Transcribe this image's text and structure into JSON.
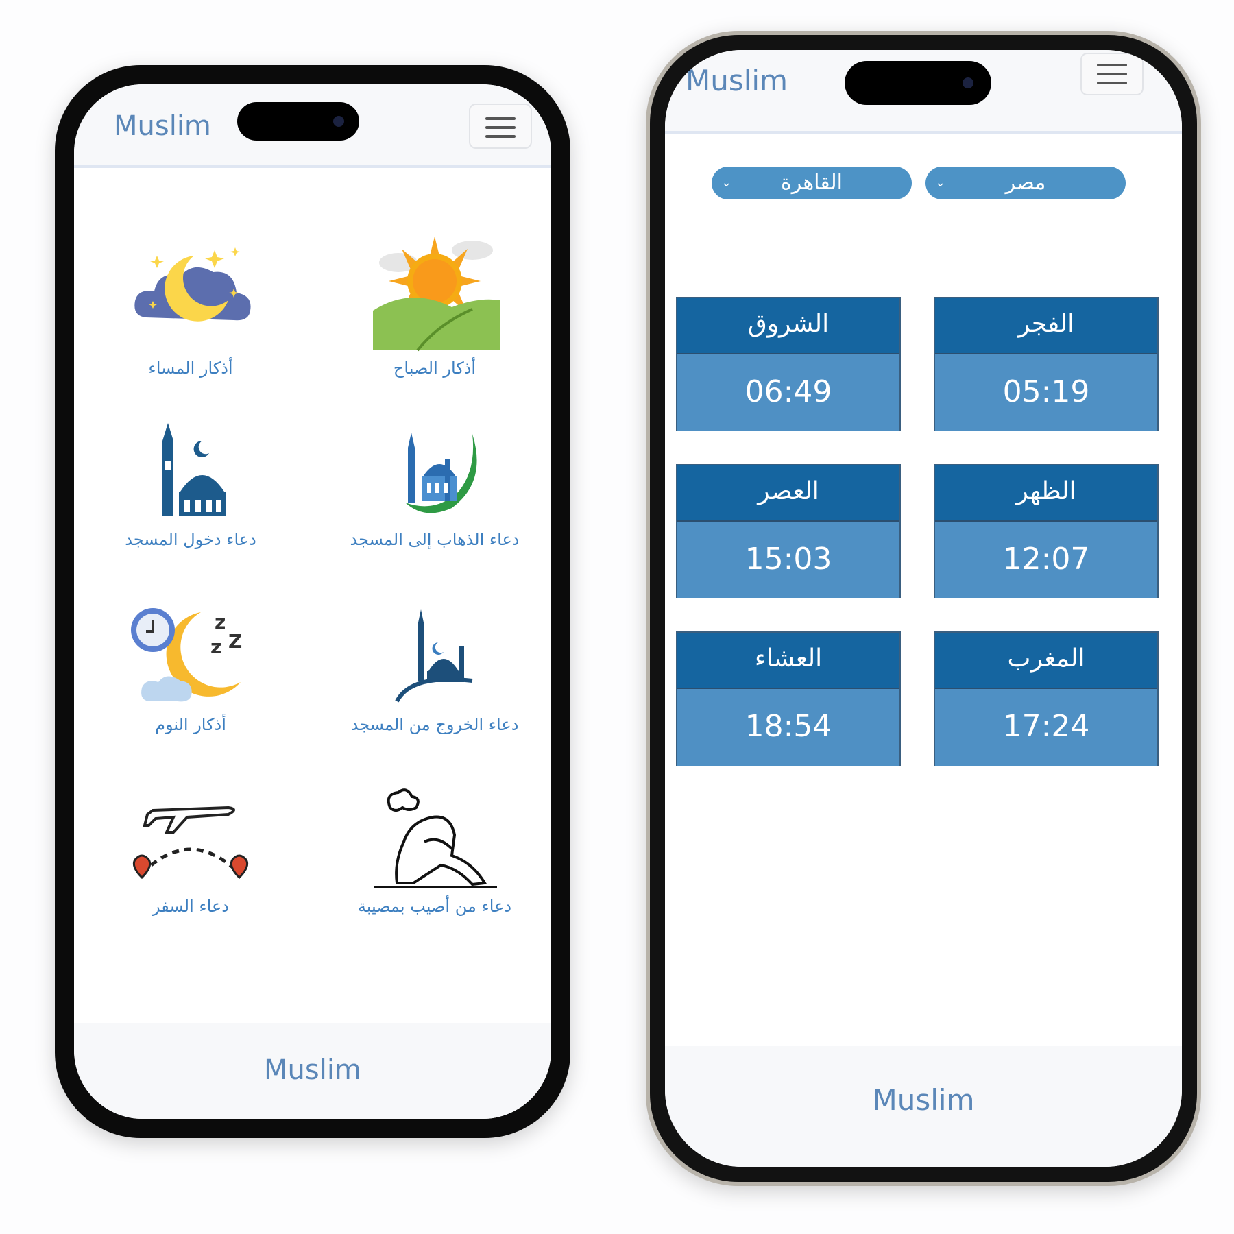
{
  "app": {
    "brand": "Muslim",
    "footer": "Muslim"
  },
  "home": {
    "tiles": [
      {
        "label": "أذكار الصباح",
        "icon": "sunrise-icon"
      },
      {
        "label": "أذكار المساء",
        "icon": "moon-cloud-icon"
      },
      {
        "label": "دعاء الذهاب إلى المسجد",
        "icon": "mosque-crescent-icon"
      },
      {
        "label": "دعاء دخول المسجد",
        "icon": "mosque-minaret-icon"
      },
      {
        "label": "دعاء الخروج من المسجد",
        "icon": "mosque-hill-icon"
      },
      {
        "label": "أذكار النوم",
        "icon": "sleep-moon-icon"
      },
      {
        "label": "دعاء من أصيب بمصيبة",
        "icon": "sad-person-icon"
      },
      {
        "label": "دعاء السفر",
        "icon": "airplane-travel-icon"
      }
    ]
  },
  "prayer": {
    "country": "مصر",
    "city": "القاهرة",
    "times": [
      {
        "name": "الفجر",
        "time": "05:19"
      },
      {
        "name": "الشروق",
        "time": "06:49"
      },
      {
        "name": "الظهر",
        "time": "12:07"
      },
      {
        "name": "العصر",
        "time": "15:03"
      },
      {
        "name": "المغرب",
        "time": "17:24"
      },
      {
        "name": "العشاء",
        "time": "18:54"
      }
    ]
  },
  "colors": {
    "brand": "#5b87b8",
    "card_header": "#1565a0",
    "card_body": "#4f90c4",
    "select": "#4d93c6",
    "label": "#3d7fc0"
  }
}
